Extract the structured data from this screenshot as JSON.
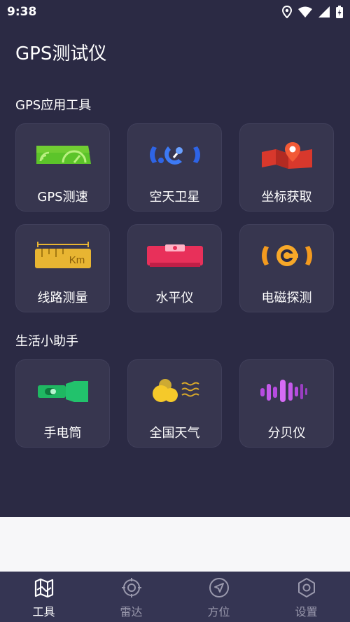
{
  "status_bar": {
    "time": "9:38"
  },
  "app": {
    "title": "GPS测试仪"
  },
  "sections": [
    {
      "title": "GPS应用工具"
    },
    {
      "title": "生活小助手"
    }
  ],
  "tools": [
    {
      "label": "GPS测速",
      "icon": "speedometer-icon",
      "color": "#6bd12f"
    },
    {
      "label": "空天卫星",
      "icon": "satellite-icon",
      "color": "#3d6ef0"
    },
    {
      "label": "坐标获取",
      "icon": "map-pin-icon",
      "color": "#e8442f"
    },
    {
      "label": "线路测量",
      "icon": "ruler-icon",
      "color": "#e8b532",
      "icon_text": "Km"
    },
    {
      "label": "水平仪",
      "icon": "level-icon",
      "color": "#e83a5e"
    },
    {
      "label": "电磁探测",
      "icon": "electromagnetic-icon",
      "color": "#f39a1f"
    }
  ],
  "helpers": [
    {
      "label": "手电筒",
      "icon": "flashlight-icon",
      "color": "#22c26c"
    },
    {
      "label": "全国天气",
      "icon": "weather-icon",
      "color": "#f2c82c"
    },
    {
      "label": "分贝仪",
      "icon": "decibel-icon",
      "color": "#b64be0"
    }
  ],
  "tabbar": {
    "items": [
      {
        "label": "工具",
        "icon": "tools-map-icon",
        "active": true
      },
      {
        "label": "雷达",
        "icon": "radar-icon",
        "active": false
      },
      {
        "label": "方位",
        "icon": "compass-icon",
        "active": false
      },
      {
        "label": "设置",
        "icon": "settings-hexagon-icon",
        "active": false
      }
    ]
  }
}
